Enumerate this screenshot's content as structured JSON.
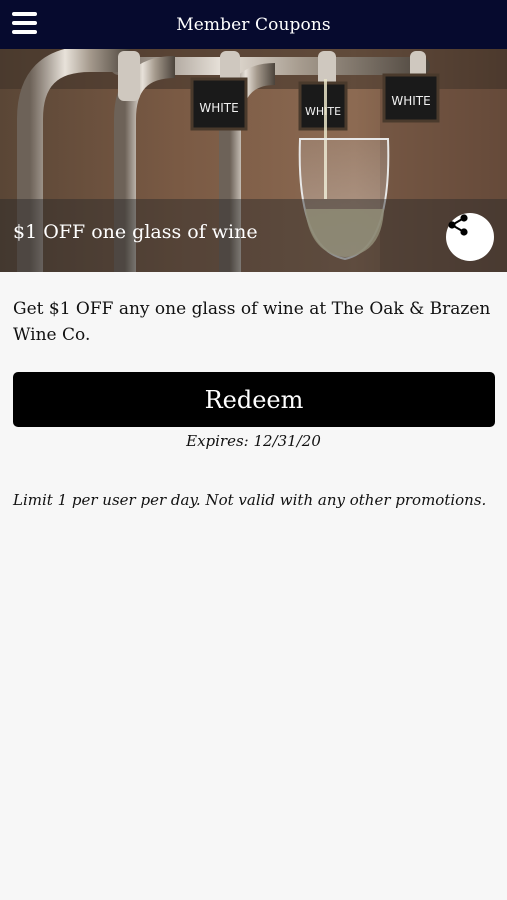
{
  "header": {
    "title": "Member Coupons",
    "menu_icon": "hamburger-menu-icon"
  },
  "coupon": {
    "headline": "$1 OFF one glass of wine",
    "description": "Get $1 OFF any one glass of wine at The Oak & Brazen Wine Co.",
    "redeem_label": "Redeem",
    "expires": "Expires: 12/31/20",
    "terms": "Limit 1 per user per day. Not valid with any other promotions.",
    "share_icon": "share-icon"
  },
  "hero_image": {
    "tap_labels": [
      "WHITE",
      "WHITE",
      "WHITE"
    ]
  },
  "colors": {
    "header_bg": "#060a2e",
    "button_bg": "#000000",
    "page_bg": "#f7f7f7"
  }
}
